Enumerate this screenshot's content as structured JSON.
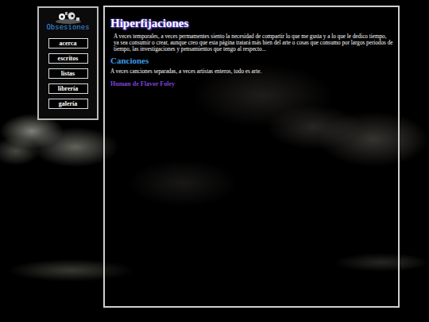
{
  "sidebar": {
    "logo": "Obsesiones",
    "items": [
      {
        "label": "acerca",
        "selected": false
      },
      {
        "label": "escritos",
        "selected": false
      },
      {
        "label": "listas",
        "selected": false
      },
      {
        "label": "librería",
        "selected": false
      },
      {
        "label": "galería",
        "selected": false
      }
    ]
  },
  "main": {
    "title": "Hiperfijaciones",
    "intro": "A veces temporales, a veces permamentes siento la necesidad de compartir lo que me gusta y a lo que le dedico tiempo, ya sea consumir o crear, aunque creo que esta página tratará más bien del arte o cosas que consumo por largos periodos de tiempo, las investigaciones y pensamientos que tengo al respecto...",
    "sections": [
      {
        "heading": "Canciones",
        "text": "A veces canciones separadas, a veces artistas enteros, todo es arte.",
        "links": [
          "Human de Flavor Foley"
        ]
      }
    ]
  }
}
